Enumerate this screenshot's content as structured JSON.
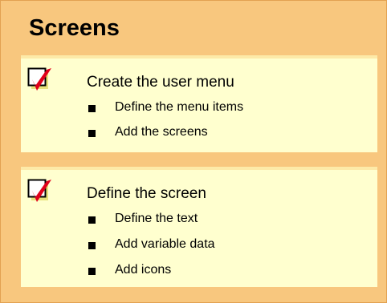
{
  "slide": {
    "title": "Screens",
    "sections": [
      {
        "icon": "checkbox-tick-icon",
        "title": "Create the user menu",
        "items": [
          "Define the menu items",
          "Add the screens"
        ]
      },
      {
        "icon": "checkbox-tick-icon",
        "title": "Define the screen",
        "items": [
          "Define the text",
          "Add variable data",
          "Add icons"
        ]
      }
    ]
  },
  "colors": {
    "frame": "#f8c77e",
    "panel": "#ffffcf",
    "tick": "#e0001b",
    "icon_shadow": "#e8e27a"
  }
}
